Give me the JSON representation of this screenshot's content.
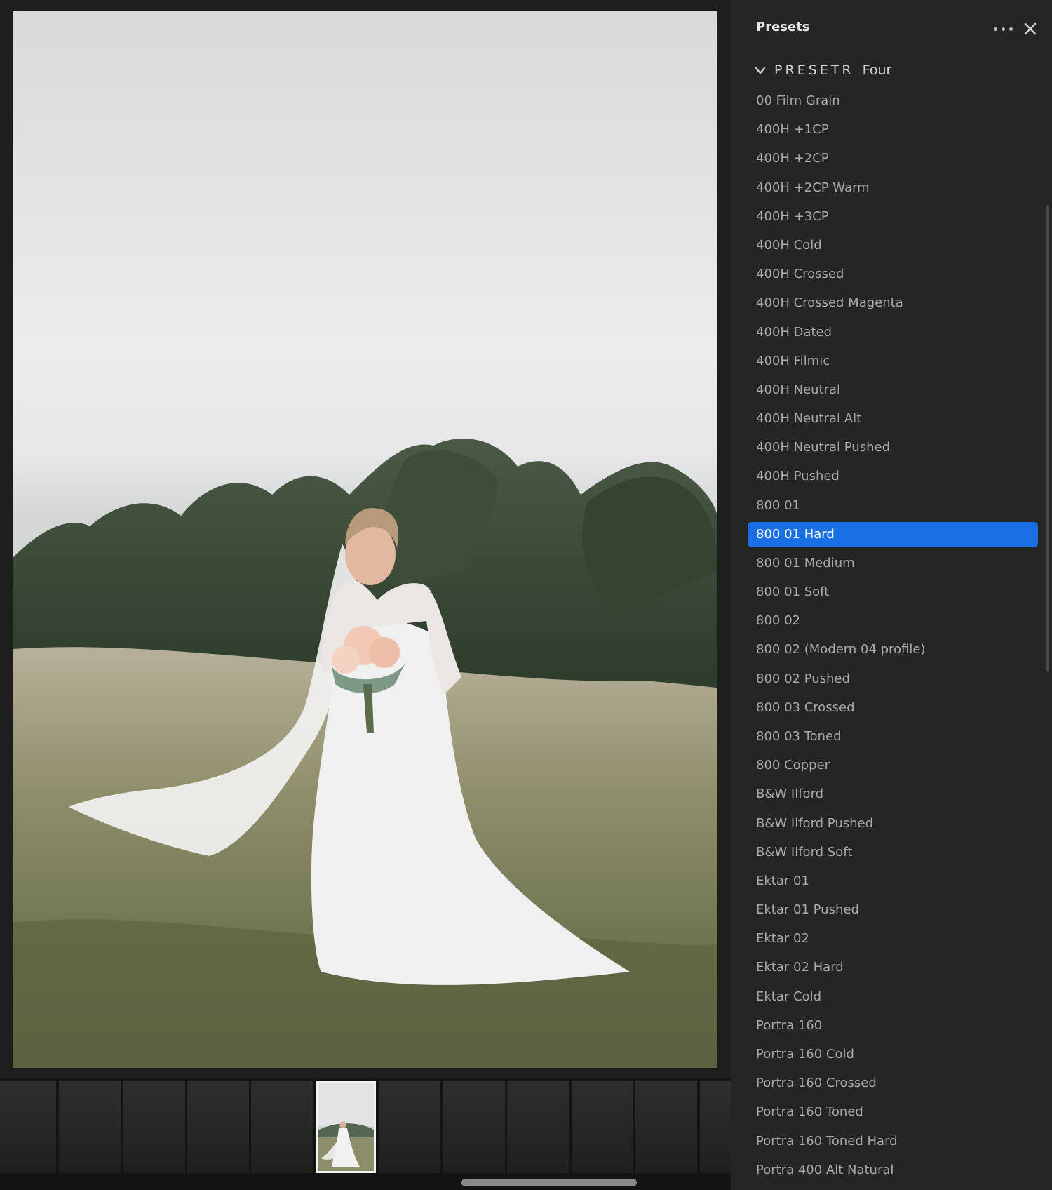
{
  "panel": {
    "title": "Presets",
    "group": {
      "name": "PRESETR",
      "suffix": "Four",
      "expanded": true
    },
    "selected_preset": "800 01 Hard",
    "presets": [
      "00 Film Grain",
      "400H +1CP",
      "400H +2CP",
      "400H +2CP Warm",
      "400H +3CP",
      "400H Cold",
      "400H Crossed",
      "400H Crossed Magenta",
      "400H Dated",
      "400H Filmic",
      "400H Neutral",
      "400H Neutral Alt",
      "400H Neutral Pushed",
      "400H Pushed",
      "800 01",
      "800 01 Hard",
      "800 01 Medium",
      "800 01 Soft",
      "800 02",
      "800 02 (Modern 04 profile)",
      "800 02 Pushed",
      "800 03 Crossed",
      "800 03 Toned",
      "800 Copper",
      "B&W Ilford",
      "B&W Ilford Pushed",
      "B&W Ilford Soft",
      "Ektar 01",
      "Ektar 01 Pushed",
      "Ektar 02",
      "Ektar 02 Hard",
      "Ektar Cold",
      "Portra 160",
      "Portra 160 Cold",
      "Portra 160 Crossed",
      "Portra 160 Toned",
      "Portra 160 Toned Hard",
      "Portra 400 Alt Natural"
    ]
  },
  "icons": {
    "more": "more-horizontal-icon",
    "close": "close-icon",
    "chevron": "chevron-down-icon"
  },
  "colors": {
    "panel_bg": "#252525",
    "selection": "#1a6fe3",
    "text": "#a9a9a9",
    "app_bg": "#1b1b1b"
  },
  "filmstrip": {
    "thumbnail_count": 12,
    "active_index": 5
  }
}
